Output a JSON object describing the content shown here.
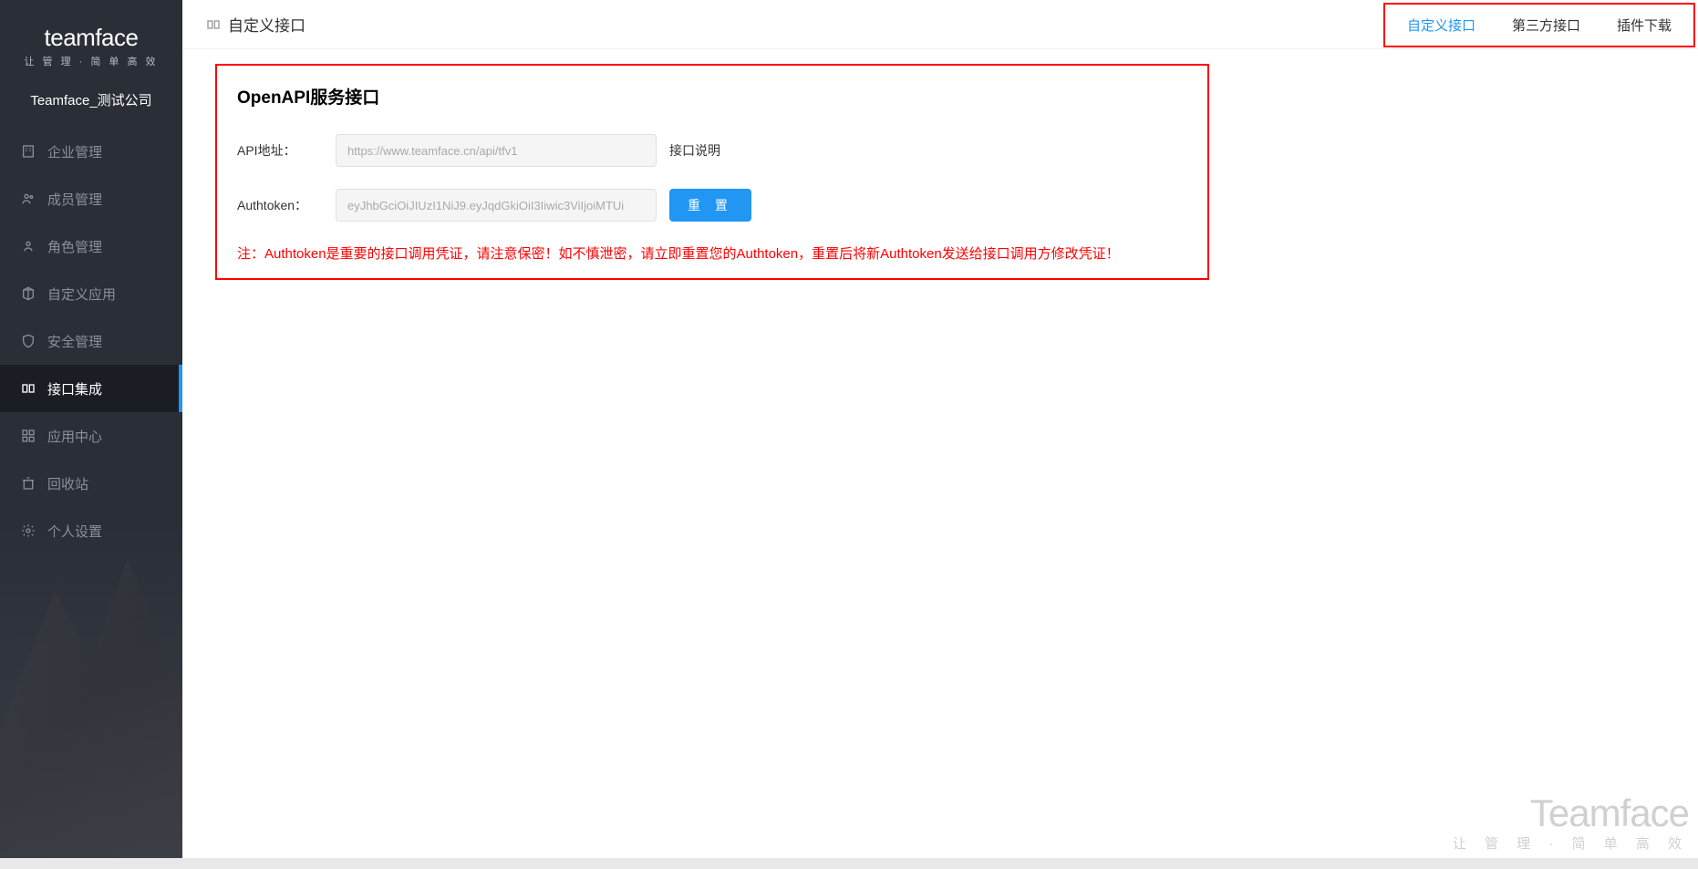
{
  "sidebar": {
    "logo": "teamface",
    "logo_subtitle": "让 管 理 · 简 单 高 效",
    "company": "Teamface_测试公司",
    "nav": [
      {
        "label": "企业管理",
        "icon": "building"
      },
      {
        "label": "成员管理",
        "icon": "users"
      },
      {
        "label": "角色管理",
        "icon": "user-role"
      },
      {
        "label": "自定义应用",
        "icon": "cube"
      },
      {
        "label": "安全管理",
        "icon": "shield"
      },
      {
        "label": "接口集成",
        "icon": "api",
        "active": true
      },
      {
        "label": "应用中心",
        "icon": "apps"
      },
      {
        "label": "回收站",
        "icon": "trash"
      },
      {
        "label": "个人设置",
        "icon": "gear"
      }
    ]
  },
  "header": {
    "title": "自定义接口",
    "tabs": [
      {
        "label": "自定义接口",
        "active": true
      },
      {
        "label": "第三方接口"
      },
      {
        "label": "插件下载"
      }
    ]
  },
  "panel": {
    "title": "OpenAPI服务接口",
    "api_url_label": "API地址：",
    "api_url_placeholder": "https://www.teamface.cn/api/tfv1",
    "api_url_link": "接口说明",
    "authtoken_label": "Authtoken：",
    "authtoken_placeholder": "eyJhbGciOiJIUzI1NiJ9.eyJqdGkiOiI3Iiwic3ViIjoiMTUi",
    "reset_btn": "重 置",
    "warning": "注：Authtoken是重要的接口调用凭证，请注意保密！如不慎泄密，请立即重置您的Authtoken，重置后将新Authtoken发送给接口调用方修改凭证！"
  },
  "watermark": {
    "main": "Teamface",
    "sub": "让 管 理 · 简 单 高 效"
  }
}
